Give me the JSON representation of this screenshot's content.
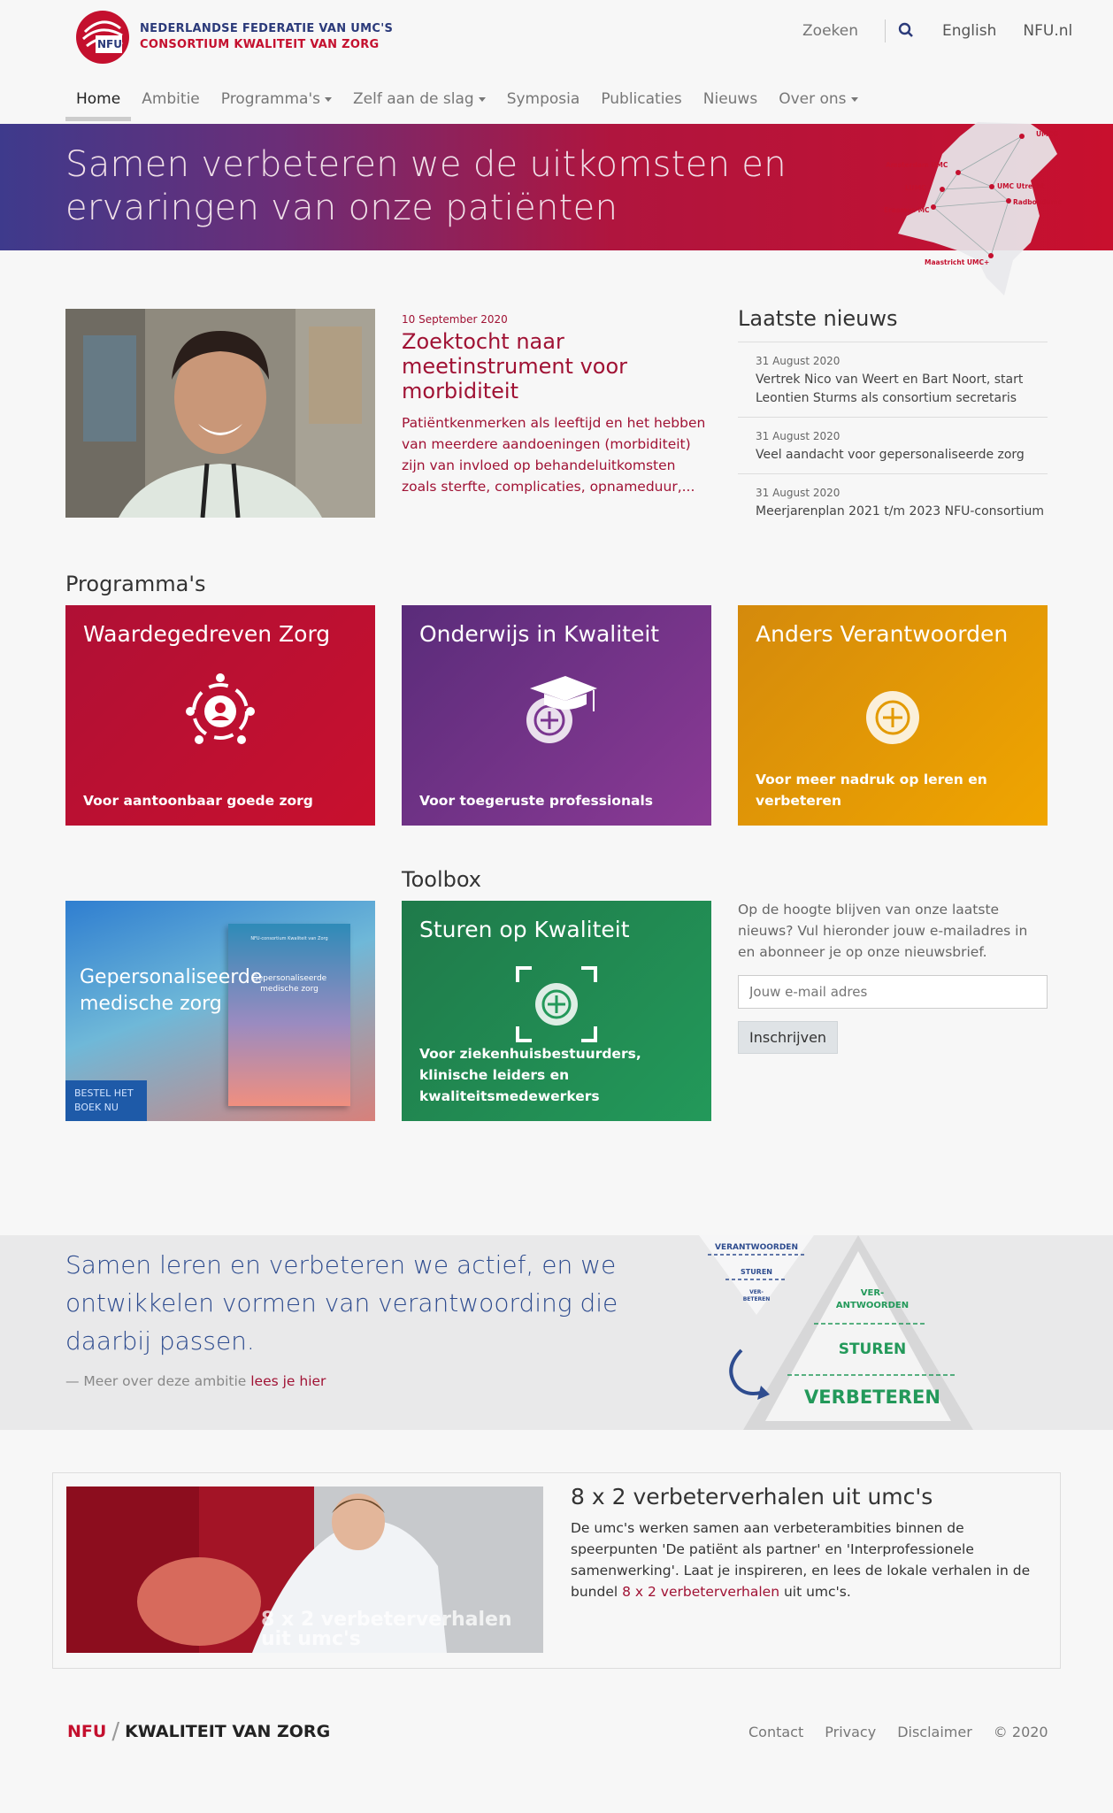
{
  "header": {
    "logo_line1": "NEDERLANDSE FEDERATIE VAN UMC'S",
    "logo_line2": "CONSORTIUM KWALITEIT VAN ZORG",
    "logo_mark": "NFU",
    "search_placeholder": "Zoeken",
    "lang_link": "English",
    "site_link": "NFU.nl"
  },
  "nav": {
    "items": [
      "Home",
      "Ambitie",
      "Programma's",
      "Zelf aan de slag",
      "Symposia",
      "Publicaties",
      "Nieuws",
      "Over ons"
    ],
    "active": "Home"
  },
  "hero": {
    "title_line1": "Samen verbeteren we de uitkomsten en",
    "title_line2": "ervaringen van onze patiënten",
    "map_labels": [
      "UMCG",
      "Amsterdam UMC",
      "LUMC",
      "UMC Utrecht",
      "Radboudumc",
      "Erasmus MC",
      "Maastricht UMC+"
    ]
  },
  "featured": {
    "date": "10 September 2020",
    "title": "Zoektocht naar meetinstrument voor morbiditeit",
    "description": "Patiëntkenmerken als leeftijd en het hebben van meerdere aandoeningen (morbiditeit) zijn van invloed op behandeluitkomsten zoals sterfte, complicaties, opnameduur,..."
  },
  "news": {
    "heading": "Laatste nieuws",
    "items": [
      {
        "date": "31 August 2020",
        "text": "Vertrek Nico van Weert en Bart Noort, start Leontien Sturms als consortium secretaris"
      },
      {
        "date": "31 August 2020",
        "text": "Veel aandacht voor gepersonaliseerde zorg"
      },
      {
        "date": "31 August 2020",
        "text": "Meerjarenplan 2021 t/m 2023 NFU-consortium"
      }
    ]
  },
  "programs": {
    "heading": "Programma's",
    "cards": [
      {
        "title": "Waardegedreven Zorg",
        "subtitle": "Voor aantoonbaar goede zorg",
        "color": "#c8102e",
        "icon": "people-circle-icon"
      },
      {
        "title": "Onderwijs in Kwaliteit",
        "subtitle": "Voor toegeruste professionals",
        "color": "#7a3590",
        "icon": "graduation-cap-icon"
      },
      {
        "title": "Anders Verantwoorden",
        "subtitle": "Voor meer nadruk op leren en verbeteren",
        "color": "#f0a500",
        "icon": "plus-gear-icon"
      }
    ]
  },
  "toolbox": {
    "heading": "Toolbox",
    "book": {
      "title_line1": "Gepersonaliseerde",
      "title_line2": "medische zorg",
      "badge_line1": "BESTEL HET",
      "badge_line2": "BOEK NU",
      "cover_header": "NFU-consortium Kwaliteit van Zorg",
      "cover_title_line1": "Gepersonaliseerde",
      "cover_title_line2": "medische zorg"
    },
    "card": {
      "title": "Sturen op Kwaliteit",
      "subtitle": "Voor ziekenhuisbestuurders, klinische leiders en kwaliteitsmedewerkers",
      "color": "#23995a"
    }
  },
  "newsletter": {
    "text": "Op de hoogte blijven van onze laatste nieuws? Vul hieronder jouw e-mailadres in en abonneer je op onze nieuwsbrief.",
    "placeholder": "Jouw e-mail adres",
    "button": "Inschrijven"
  },
  "ambition": {
    "text": "Samen leren en verbeteren we actief, en we ontwikkelen vormen van verantwoording die daarbij passen.",
    "link_prefix": "— Meer over deze ambitie ",
    "link_text": "lees je hier",
    "diagram_small": [
      "VERANTWOORDEN",
      "STUREN",
      "VER-",
      "BETEREN"
    ],
    "diagram_large": [
      "VER-",
      "ANTWOORDEN",
      "STUREN",
      "VERBETEREN"
    ]
  },
  "stories": {
    "title": "8 x 2 verbeterverhalen uit umc's",
    "desc_prefix": "De umc's werken samen aan verbeterambities binnen de speerpunten 'De patiënt als partner' en 'Interprofessionele samenwerking'. Laat je inspireren, en lees de lokale verhalen in de bundel ",
    "desc_link": "8 x 2 verbeterverhalen",
    "desc_suffix": " uit umc's.",
    "image_caption_line1": "8 x 2 verbeterverhalen",
    "image_caption_line2": "uit umc's"
  },
  "footer": {
    "logo_nfu": "NFU",
    "logo_sep": "/",
    "logo_kvz": "KWALITEIT VAN ZORG",
    "links": [
      "Contact",
      "Privacy",
      "Disclaimer",
      "© 2020"
    ]
  }
}
